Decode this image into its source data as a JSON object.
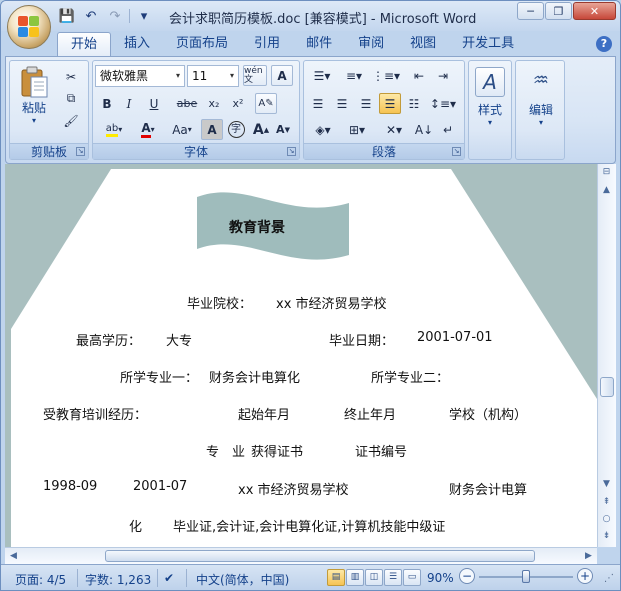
{
  "window": {
    "title": "会计求职简历模板.doc [兼容模式] - Microsoft Word",
    "controls": {
      "minimize": "─",
      "restore": "❐",
      "close": "✕"
    }
  },
  "qat": {
    "save": "💾",
    "undo": "↶",
    "redo": "↷",
    "more": "▾"
  },
  "tabs": [
    "开始",
    "插入",
    "页面布局",
    "引用",
    "邮件",
    "审阅",
    "视图",
    "开发工具"
  ],
  "ribbon": {
    "clipboard": {
      "label": "剪贴板",
      "paste": "粘贴"
    },
    "font": {
      "label": "字体",
      "font_name": "微软雅黑",
      "font_size": "11",
      "bold": "B",
      "italic": "I",
      "underline": "U",
      "strike": "abe",
      "subscript": "x₂",
      "superscript": "x²",
      "case": "Aa",
      "grow": "A",
      "shrink": "A",
      "pinyin": "wén 文",
      "border_char": "A",
      "shading_char": "A",
      "enclose_char": "字"
    },
    "paragraph": {
      "label": "段落"
    },
    "styles": {
      "label": "样式"
    },
    "editing": {
      "label": "编辑"
    }
  },
  "document": {
    "heading": "教育背景",
    "rows": [
      {
        "key": "school",
        "label": "毕业院校：",
        "value": "xx 市经济贸易学校"
      },
      {
        "key": "degree",
        "label": "最高学历：",
        "value": "大专"
      },
      {
        "key": "grad_date",
        "label": "毕业日期：",
        "value": "2001-07-01"
      },
      {
        "key": "major1",
        "label": "所学专业一：",
        "value": "财务会计电算化"
      },
      {
        "key": "major2",
        "label": "所学专业二：",
        "value": ""
      },
      {
        "key": "training",
        "label": "受教育培训经历：",
        "value": ""
      }
    ],
    "table_headers": [
      "起始年月",
      "终止年月",
      "学校（机构）",
      "专　业",
      "获得证书",
      "证书编号"
    ],
    "entry": {
      "start": "1998-09",
      "end": "2001-07",
      "school": "xx 市经济贸易学校",
      "major_part1": "财务会计电算",
      "major_part2": "化",
      "certs": "毕业证,会计证,会计电算化证,计算机技能中级证"
    }
  },
  "statusbar": {
    "page": "页面: 4/5",
    "words": "字数: 1,263",
    "language": "中文(简体，中国)",
    "zoom": "90%",
    "zoom_fraction": 0.5
  },
  "colors": {
    "ribbon_bg": "#d8e5f5",
    "doc_decor": "#a9bfbf",
    "accent_text": "#15428b"
  }
}
